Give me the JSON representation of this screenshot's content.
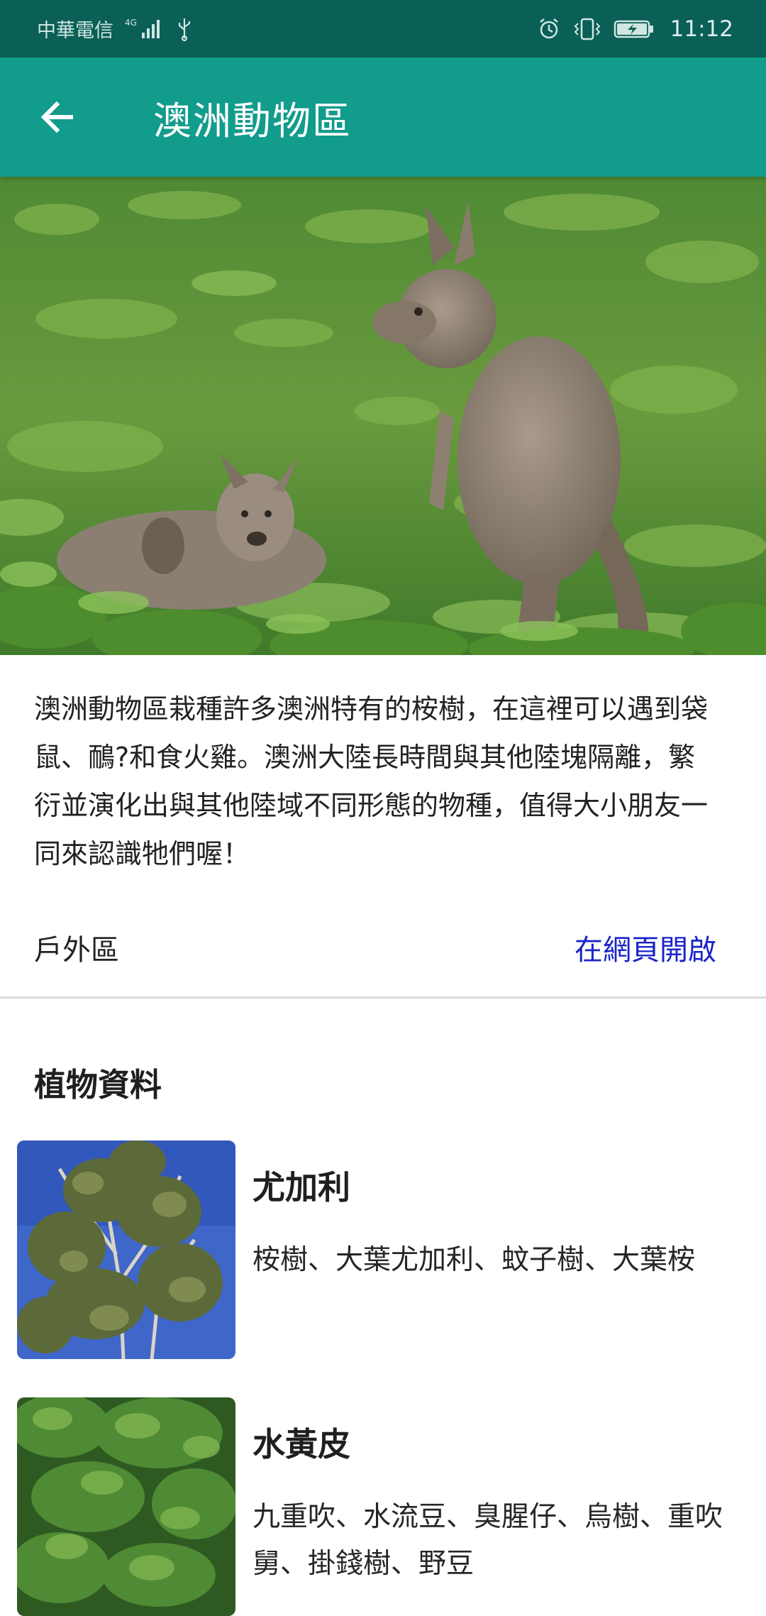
{
  "status_bar": {
    "carrier": "中華電信",
    "network": "4G",
    "time": "11:12"
  },
  "app_bar": {
    "title": "澳洲動物區",
    "back_icon": "arrow-left-icon"
  },
  "hero": {
    "subject": "kangaroos"
  },
  "description": "澳洲動物區栽種許多澳洲特有的桉樹，在這裡可以遇到袋鼠、鴯?和食火雞。澳洲大陸長時間與其他陸塊隔離，繁衍並演化出與其他陸域不同形態的物種，值得大小朋友一同來認識牠們喔！",
  "meta": {
    "area": "戶外區",
    "open_web_label": "在網頁開啟",
    "link_color": "#1a24c8"
  },
  "plants": {
    "section_title": "植物資料",
    "items": [
      {
        "name": "尤加利",
        "aliases": "桉樹、大葉尤加利、蚊子樹、大葉桉"
      },
      {
        "name": "水黃皮",
        "aliases": "九重吹、水流豆、臭腥仔、烏樹、重吹舅、掛錢樹、野豆"
      }
    ]
  },
  "colors": {
    "status_bar": "#0a5f56",
    "app_bar": "#119c8b"
  }
}
